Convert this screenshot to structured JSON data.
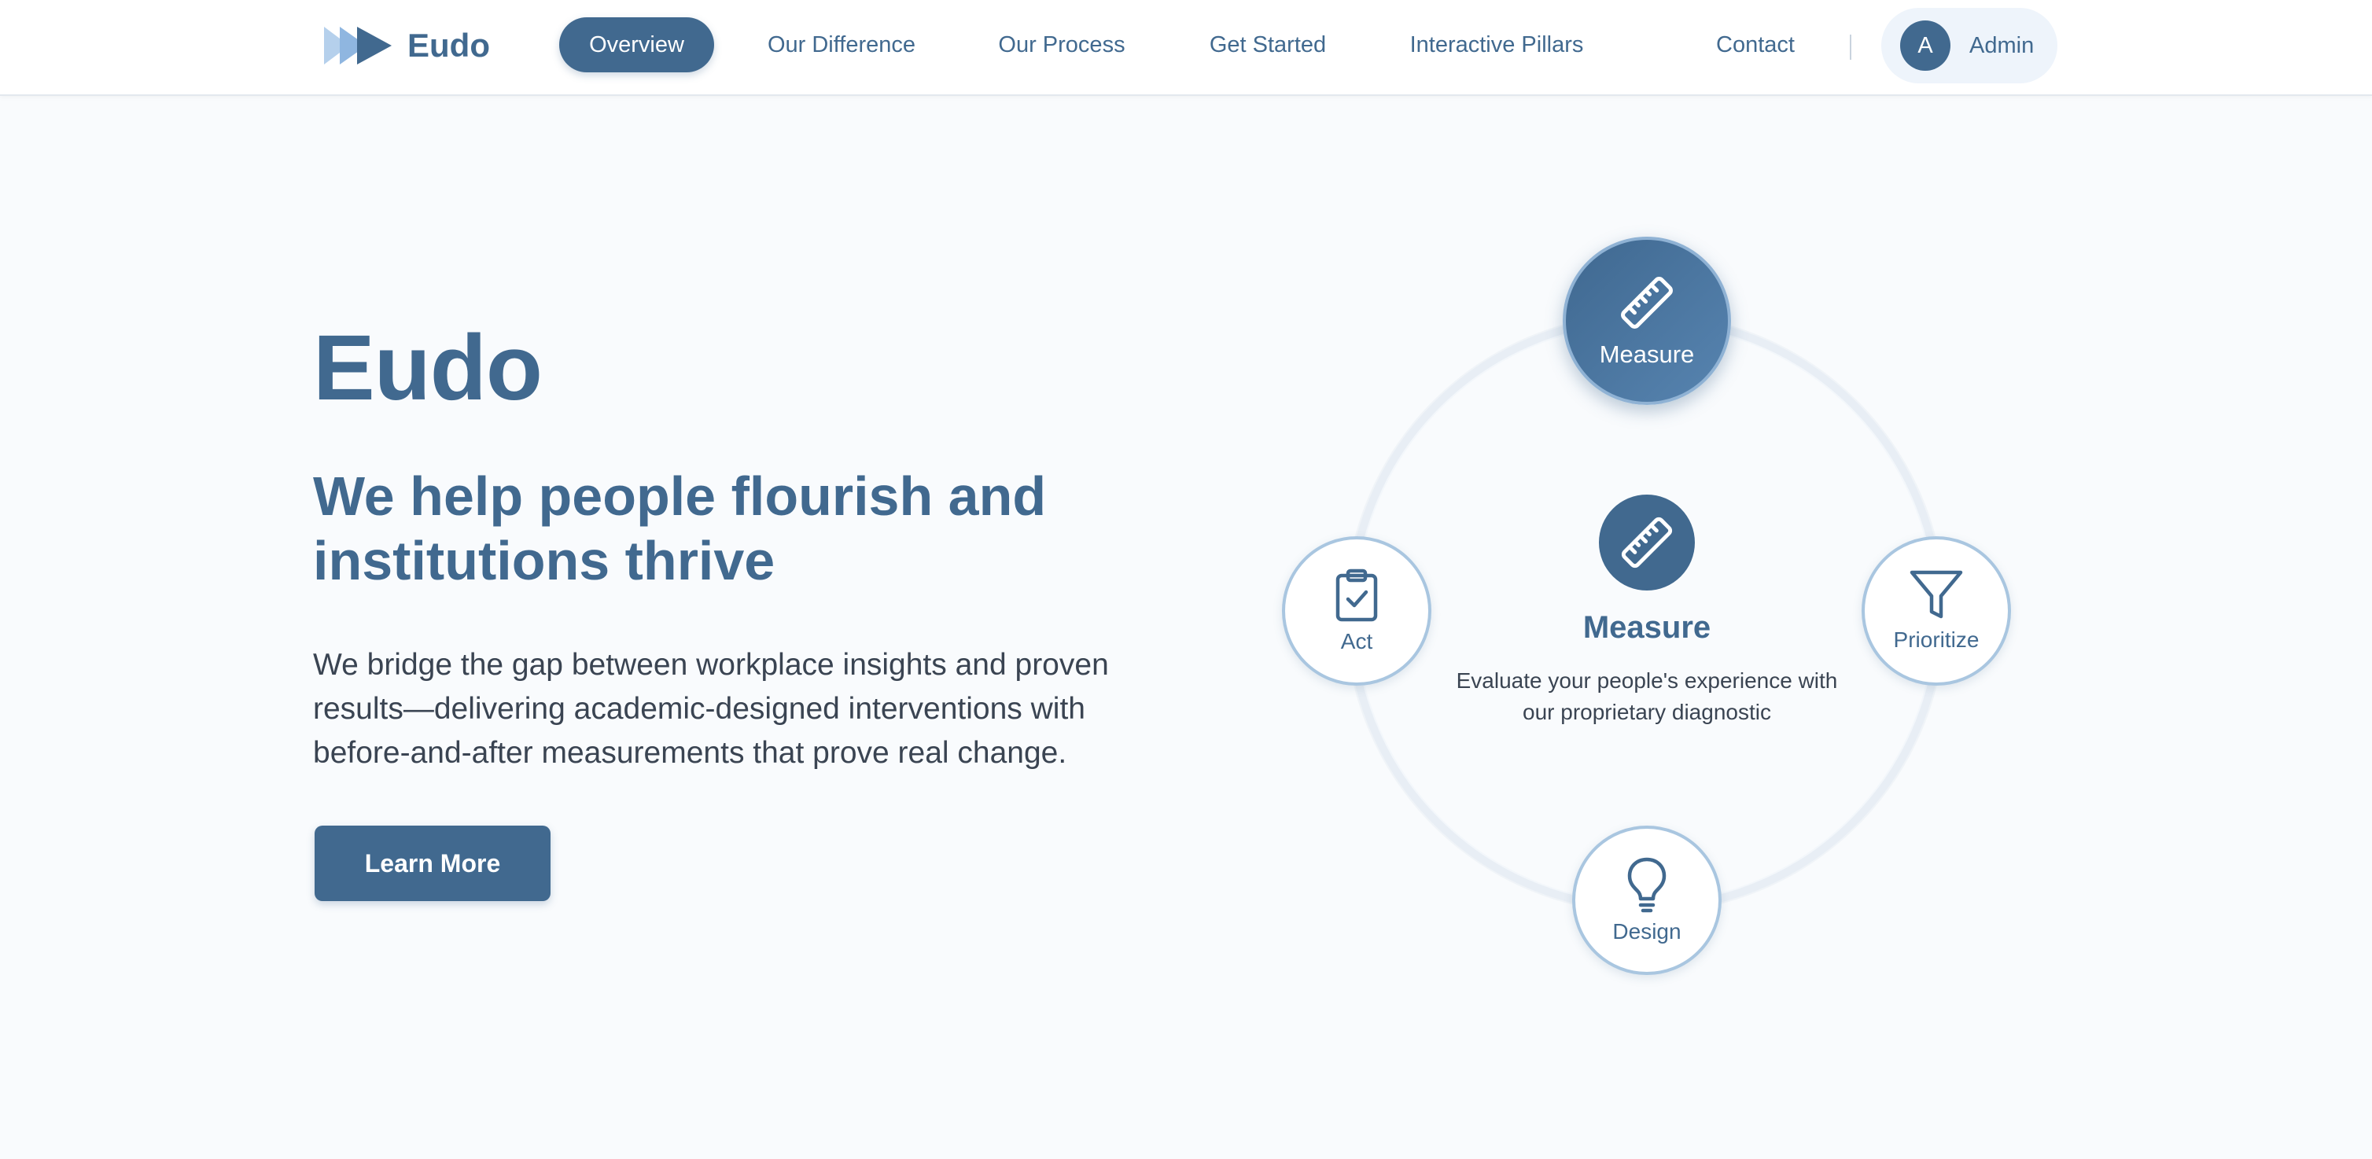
{
  "brand": {
    "name": "Eudo",
    "logo_icon": "chevron-arrows-logo"
  },
  "nav": {
    "items": [
      {
        "label": "Overview",
        "active": true
      },
      {
        "label": "Our Difference",
        "active": false
      },
      {
        "label": "Our Process",
        "active": false
      },
      {
        "label": "Get Started",
        "active": false
      },
      {
        "label": "Interactive Pillars",
        "active": false
      },
      {
        "label": "Contact",
        "active": false
      }
    ],
    "admin": {
      "avatar_initial": "A",
      "label": "Admin"
    }
  },
  "hero": {
    "title": "Eudo",
    "subtitle": "We help people flourish and institutions thrive",
    "description": "We bridge the gap between workplace insights and proven results—delivering academic-designed interventions with before-and-after measurements that prove real change.",
    "cta_label": "Learn More"
  },
  "cycle": {
    "nodes": [
      {
        "label": "Measure",
        "icon": "ruler-icon",
        "active": true
      },
      {
        "label": "Prioritize",
        "icon": "funnel-icon",
        "active": false
      },
      {
        "label": "Design",
        "icon": "lightbulb-icon",
        "active": false
      },
      {
        "label": "Act",
        "icon": "clipboard-check-icon",
        "active": false
      }
    ],
    "center": {
      "icon": "ruler-icon",
      "title": "Measure",
      "description": "Evaluate your people's experience with our proprietary diagnostic"
    }
  },
  "colors": {
    "primary": "#41698f",
    "primary_light": "#a9c6e0",
    "background": "#f9fbfd",
    "text": "#3a4452",
    "logo_light": "#8fb6e0"
  }
}
